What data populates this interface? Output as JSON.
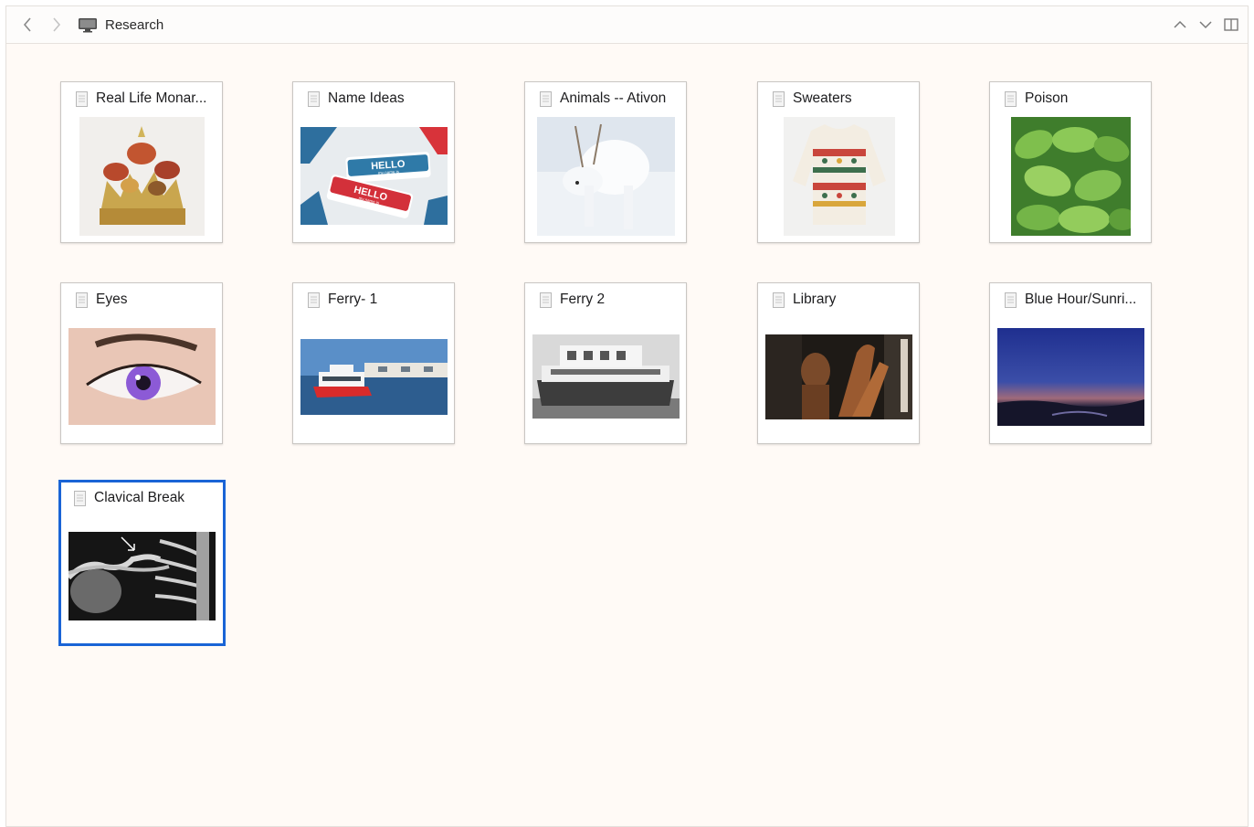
{
  "window": {
    "breadcrumb": "Research",
    "icons": {
      "back": "chevron-left-icon",
      "forward": "chevron-right-icon",
      "location": "desktop-computer-icon",
      "scroll_up": "chevron-up-icon",
      "scroll_down": "chevron-down-icon",
      "sidebar_toggle": "sidebar-panel-icon"
    }
  },
  "colors": {
    "background": "#fffaf6",
    "selection": "#1a64d6"
  },
  "cards": [
    {
      "title": "Real Life Monar...",
      "image": "butterfly-crown"
    },
    {
      "title": "Name Ideas",
      "image": "hello-name-tags"
    },
    {
      "title": "Animals -- Ativon",
      "image": "white-reindeer"
    },
    {
      "title": "Sweaters",
      "image": "fair-isle-sweater"
    },
    {
      "title": "Poison",
      "image": "tobacco-leaves"
    },
    {
      "title": "Eyes",
      "image": "purple-eye"
    },
    {
      "title": "Ferry- 1",
      "image": "red-white-ferry"
    },
    {
      "title": "Ferry 2",
      "image": "bw-ferry-boat"
    },
    {
      "title": "Library",
      "image": "wood-sculpture"
    },
    {
      "title": "Blue Hour/Sunri...",
      "image": "blue-hour-landscape"
    },
    {
      "title": "Clavical Break",
      "image": "clavicle-xray",
      "selected": true
    }
  ],
  "thumb_text": {
    "hello_top": "HELLO",
    "hello_top_sub": "my name is",
    "hello_bottom": "HELLO",
    "hello_bottom_sub": "my name is"
  }
}
